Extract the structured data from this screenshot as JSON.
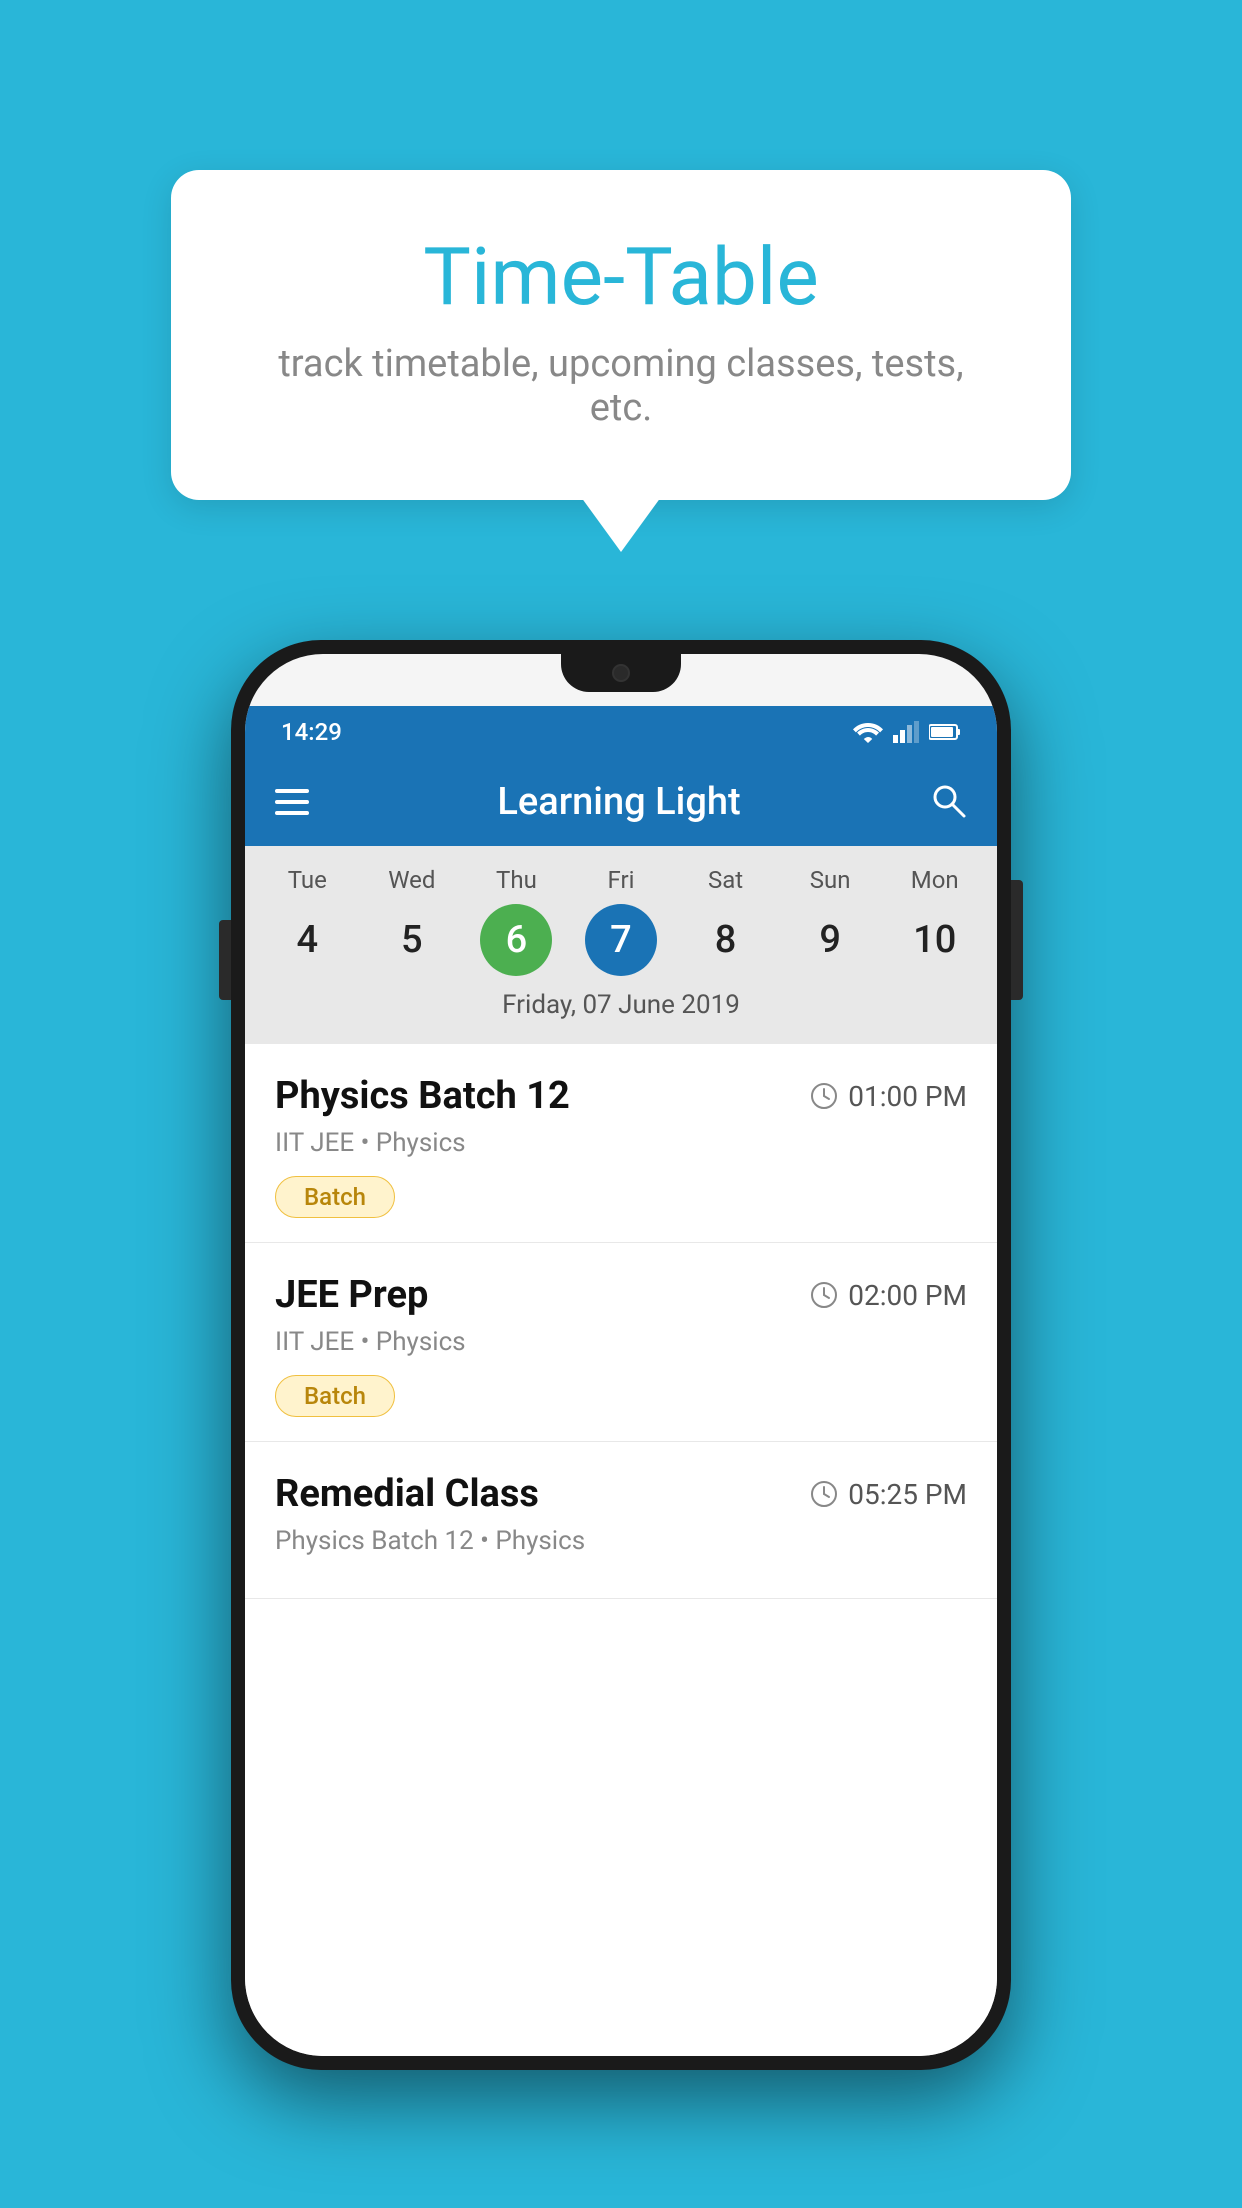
{
  "background_color": "#29B6D8",
  "speech_bubble": {
    "title": "Time-Table",
    "subtitle": "track timetable, upcoming classes, tests, etc."
  },
  "phone": {
    "status_bar": {
      "time": "14:29"
    },
    "app_bar": {
      "title": "Learning Light"
    },
    "calendar": {
      "days": [
        {
          "label": "Tue",
          "num": "4"
        },
        {
          "label": "Wed",
          "num": "5"
        },
        {
          "label": "Thu",
          "num": "6",
          "state": "today"
        },
        {
          "label": "Fri",
          "num": "7",
          "state": "selected"
        },
        {
          "label": "Sat",
          "num": "8"
        },
        {
          "label": "Sun",
          "num": "9"
        },
        {
          "label": "Mon",
          "num": "10"
        }
      ],
      "selected_date": "Friday, 07 June 2019"
    },
    "schedule": [
      {
        "name": "Physics Batch 12",
        "time": "01:00 PM",
        "sub": "IIT JEE • Physics",
        "tag": "Batch"
      },
      {
        "name": "JEE Prep",
        "time": "02:00 PM",
        "sub": "IIT JEE • Physics",
        "tag": "Batch"
      },
      {
        "name": "Remedial Class",
        "time": "05:25 PM",
        "sub": "Physics Batch 12 • Physics",
        "tag": ""
      }
    ]
  },
  "icons": {
    "hamburger": "hamburger-icon",
    "search": "search-icon",
    "clock": "clock-icon"
  }
}
